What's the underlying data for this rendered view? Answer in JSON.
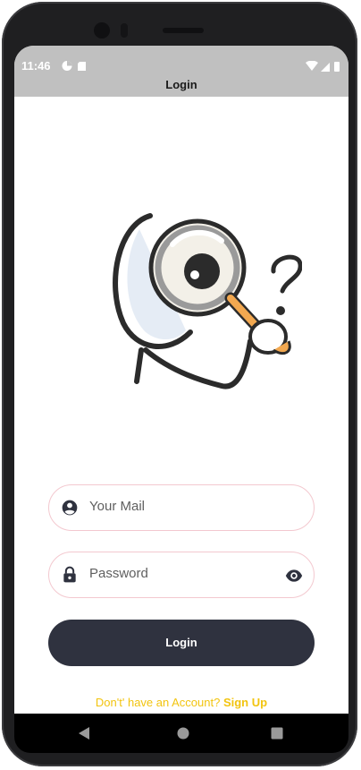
{
  "status_bar": {
    "time": "11:46",
    "left_icons": [
      "data-saver-icon",
      "sd-card-icon"
    ],
    "right_icons": [
      "wifi-icon",
      "signal-icon",
      "battery-icon"
    ]
  },
  "app_bar": {
    "title": "Login"
  },
  "illustration": {
    "name": "magnifying-glass-eye-illustration"
  },
  "form": {
    "email": {
      "placeholder": "Your Mail",
      "icon": "account-circle-icon"
    },
    "password": {
      "placeholder": "Password",
      "icon": "lock-icon",
      "toggle_icon": "eye-icon"
    },
    "login_button": "Login",
    "signup_prompt": "Don't' have an Account?",
    "signup_link": "Sign Up"
  },
  "colors": {
    "app_bar": "#c0c0c0",
    "field_border": "#f3c8cf",
    "button": "#2f323f",
    "accent": "#f2c40f"
  }
}
